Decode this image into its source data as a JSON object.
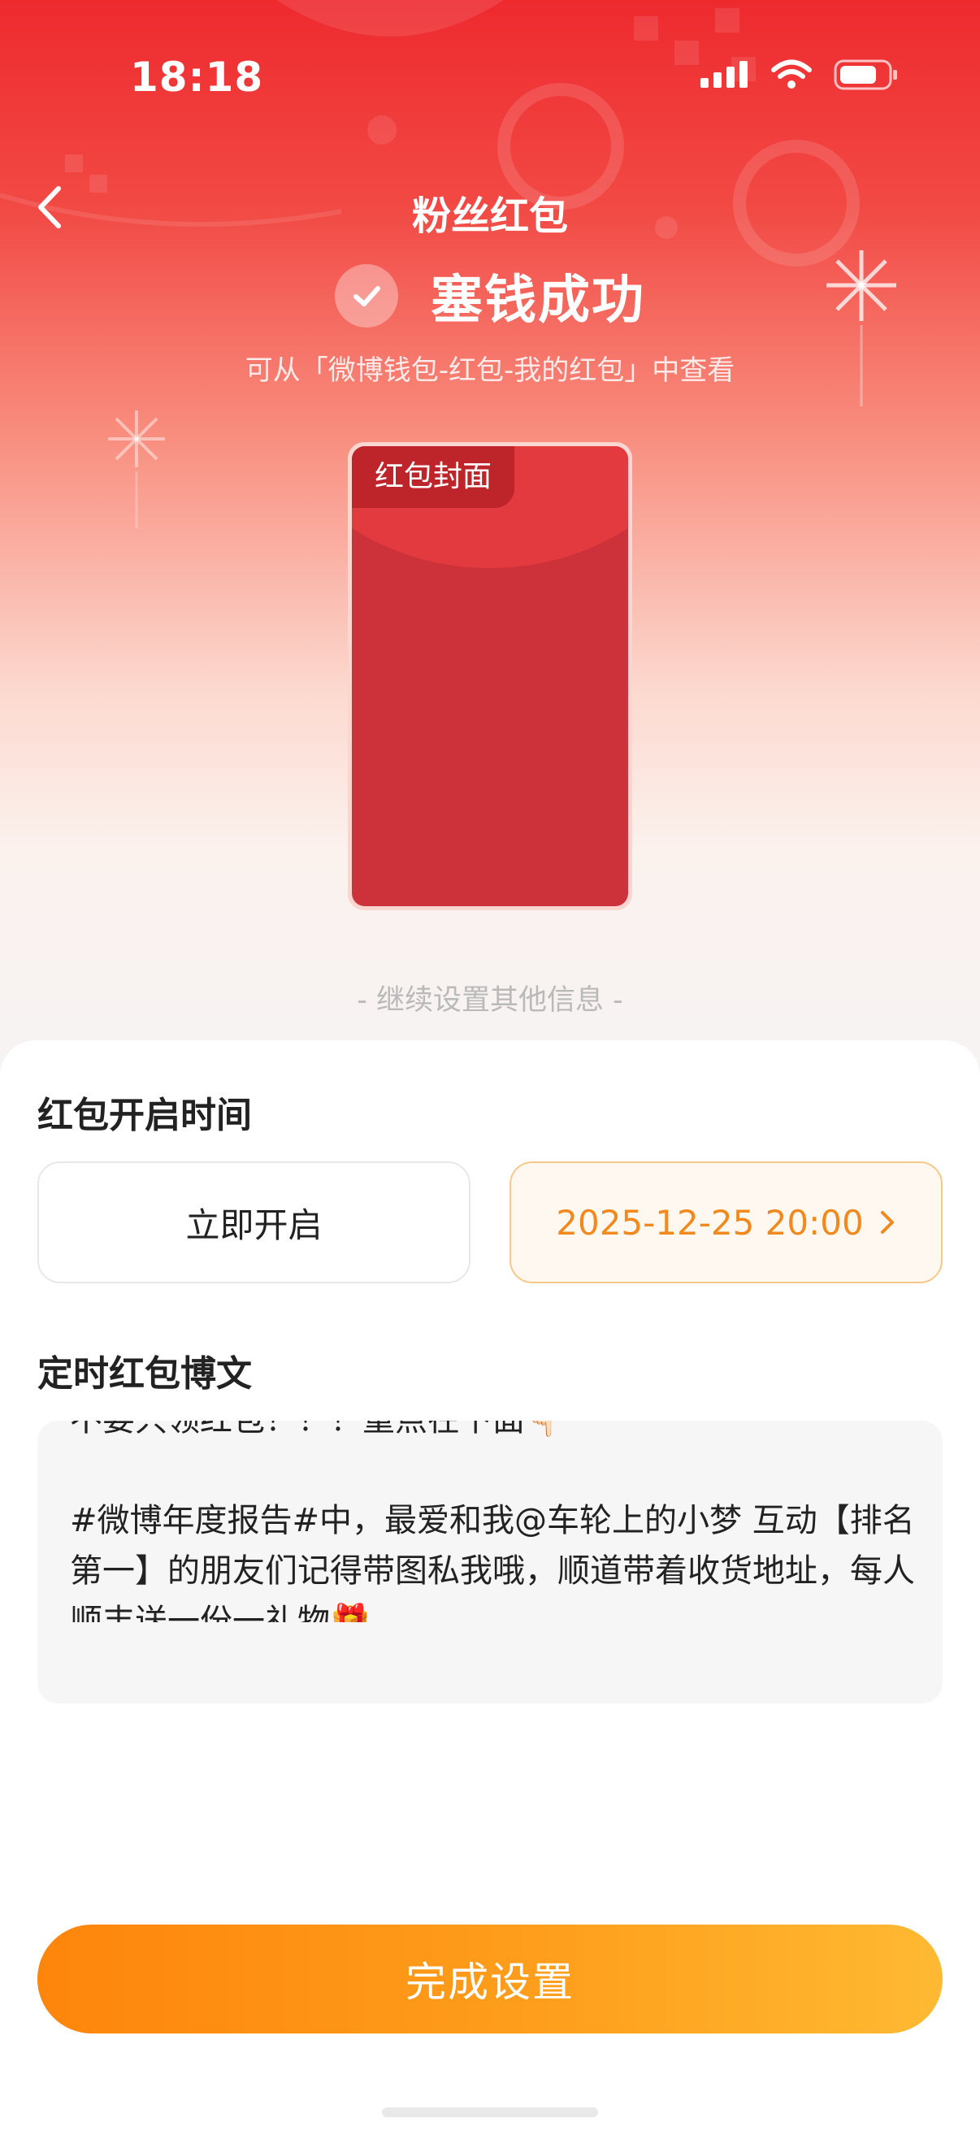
{
  "status_bar": {
    "time": "18:18",
    "icons": [
      "signal-icon",
      "wifi-icon",
      "battery-icon"
    ]
  },
  "nav": {
    "title": "粉丝红包",
    "back_icon": "chevron-left-icon"
  },
  "success": {
    "title": "塞钱成功",
    "subtitle": "可从「微博钱包-红包-我的红包」中查看"
  },
  "envelope": {
    "tag": "红包封面"
  },
  "continue_text": "- 继续设置其他信息 -",
  "open_time": {
    "title": "红包开启时间",
    "now_label": "立即开启",
    "scheduled_label": "2025-12-25 20:00",
    "scheduled_selected": true
  },
  "post": {
    "title": "定时红包博文",
    "text": "不要只领红包！！！重点在下面👇🏻\n\n#微博年度报告#中，最爱和我@车轮上的小梦 互动【排名第一】的朋友们记得带图私我哦，顺道带着收货地址，每人顺丰送一份一礼物🎁"
  },
  "finish_button": "完成设置",
  "colors": {
    "brand_red": "#ee2a2f",
    "accent_orange": "#f08a1e",
    "button_start": "#fe850c",
    "button_end": "#ffb932"
  }
}
